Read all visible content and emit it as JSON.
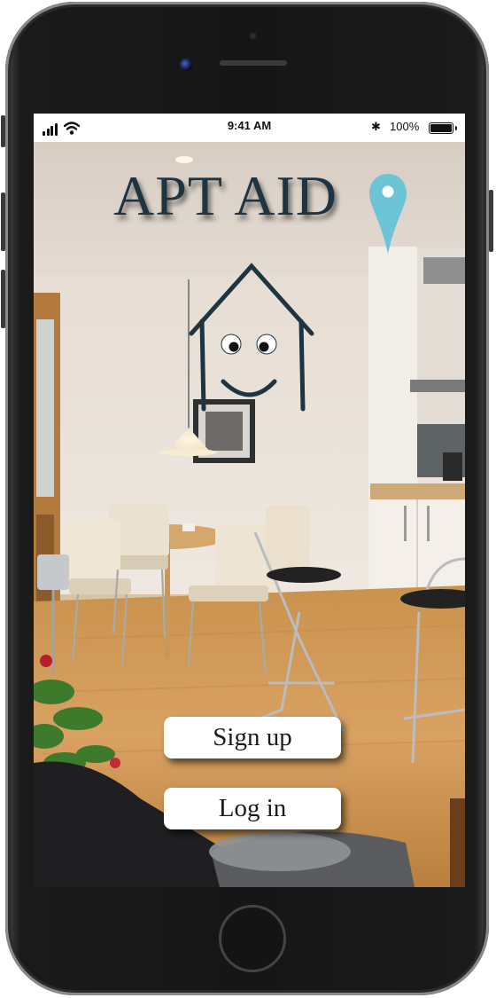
{
  "status_bar": {
    "time": "9:41 AM",
    "battery_percent": "100%",
    "bluetooth_icon": "bluetooth-icon",
    "signal_icon": "cellular-signal-icon",
    "wifi_icon": "wifi-icon",
    "battery_icon": "battery-full-icon"
  },
  "app": {
    "title": "APT AID",
    "logo_icon": "smiling-house-icon",
    "pin_icon": "location-pin-icon",
    "background": "apartment-interior-photo"
  },
  "actions": {
    "signup_label": "Sign up",
    "login_label": "Log in"
  },
  "colors": {
    "title": "#1e3440",
    "pin": "#6cc4d6",
    "button_bg": "#ffffff"
  }
}
